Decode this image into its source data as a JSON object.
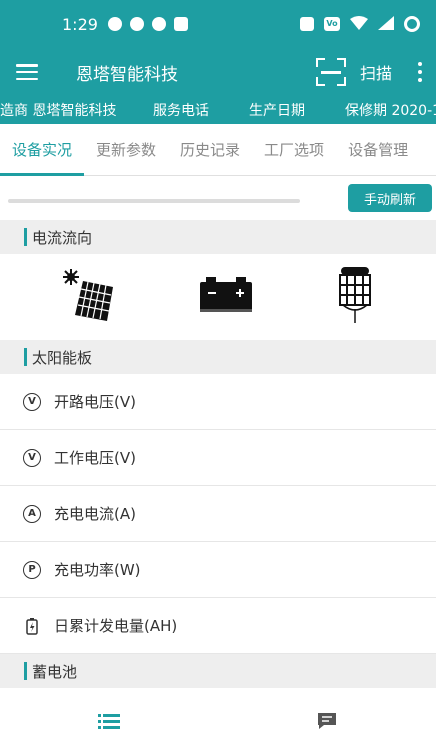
{
  "status_bar": {
    "time": "1:29"
  },
  "app_bar": {
    "title": "恩塔智能科技",
    "scan_label": "扫描"
  },
  "ticker": {
    "items": [
      "造商 恩塔智能科技",
      "服务电话",
      "生产日期",
      "保修期  2020-1"
    ]
  },
  "tabs": [
    {
      "label": "设备实况",
      "active": true
    },
    {
      "label": "更新参数",
      "active": false
    },
    {
      "label": "历史记录",
      "active": false
    },
    {
      "label": "工厂选项",
      "active": false
    },
    {
      "label": "设备管理",
      "active": false
    }
  ],
  "refresh": {
    "button_label": "手动刷新",
    "progress": 0.0
  },
  "sections": {
    "flow_title": "电流流向",
    "solar_title": "太阳能板",
    "battery_title": "蓄电池"
  },
  "solar_rows": [
    {
      "label": "开路电压(V)",
      "icon": "voltage-icon",
      "symbol": "V"
    },
    {
      "label": "工作电压(V)",
      "icon": "voltage-icon",
      "symbol": "V"
    },
    {
      "label": "充电电流(A)",
      "icon": "ampere-icon",
      "symbol": "A"
    },
    {
      "label": "充电功率(W)",
      "icon": "power-icon",
      "symbol": "P"
    },
    {
      "label": "日累计发电量(AH)",
      "icon": "battery-charge-icon",
      "symbol": ""
    }
  ],
  "colors": {
    "accent": "#1e9ea2"
  }
}
